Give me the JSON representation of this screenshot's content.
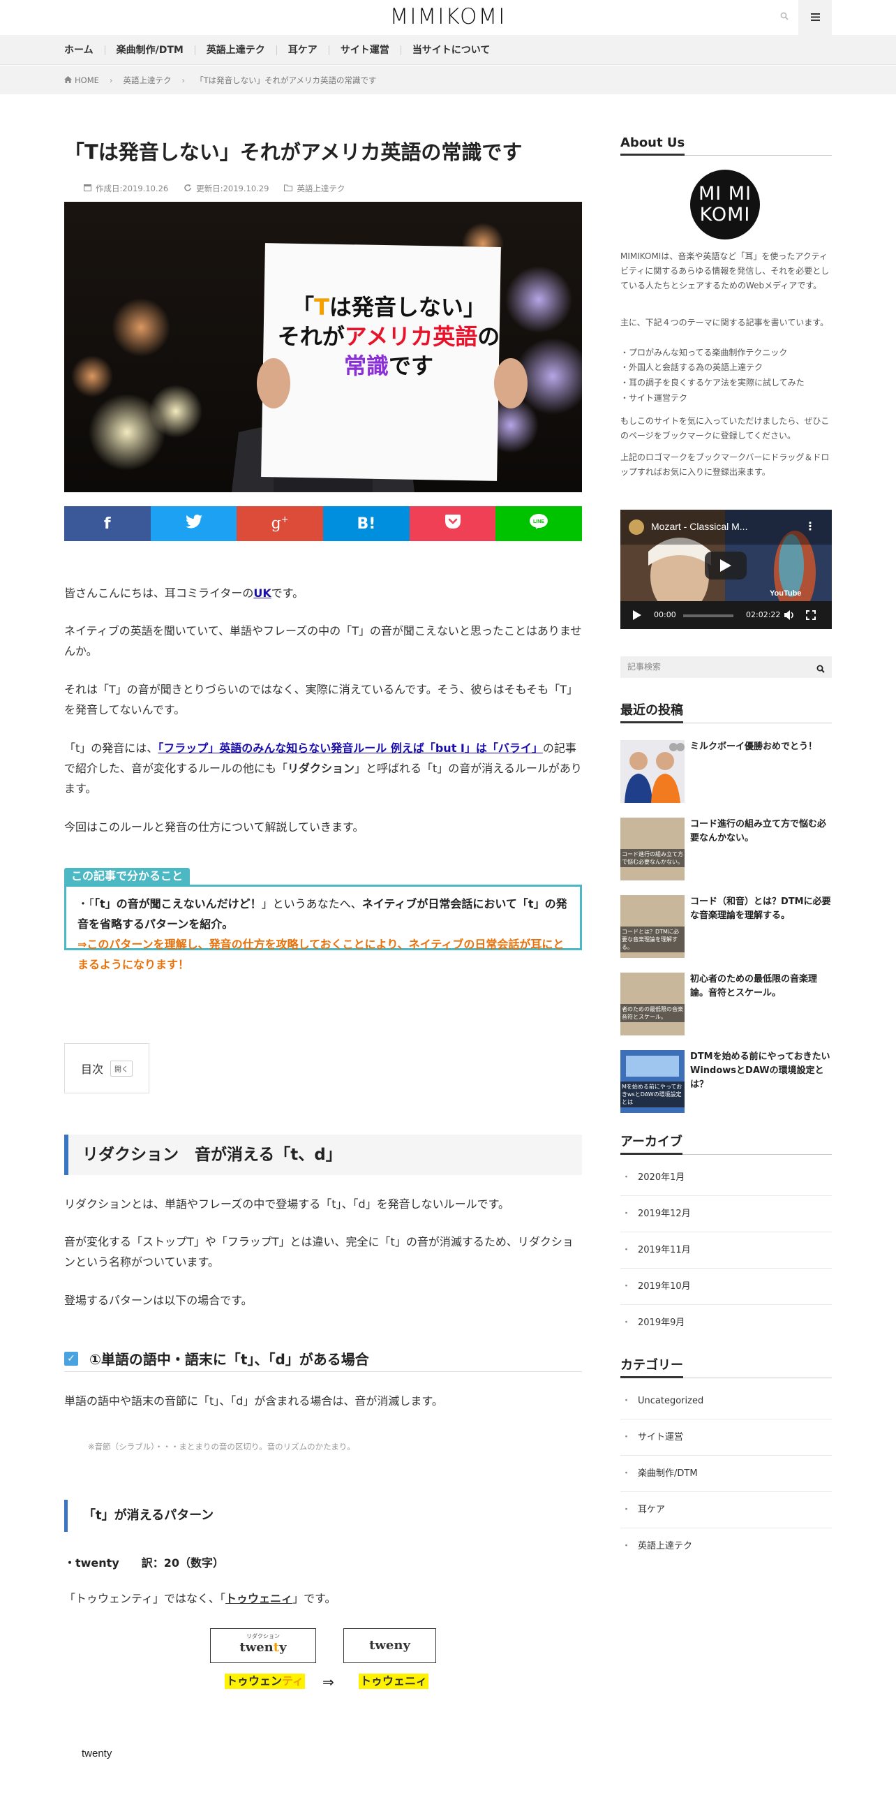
{
  "header": {
    "logo": "MIMIKOMI"
  },
  "nav": {
    "items": [
      "ホーム",
      "楽曲制作/DTM",
      "英語上達テク",
      "耳ケア",
      "サイト運営",
      "当サイトについて"
    ]
  },
  "breadcrumb": {
    "home": "HOME",
    "category": "英語上達テク",
    "current": "「Tは発音しない」それがアメリカ英語の常識です"
  },
  "article": {
    "title": "「Tは発音しない」それがアメリカ英語の常識です",
    "created": "作成日:2019.10.26",
    "updated": "更新日:2019.10.29",
    "category": "英語上達テク",
    "eyecatch": {
      "line1_a": "「",
      "line1_t": "T",
      "line1_b": "は発音しない」",
      "line2_a": "それが",
      "line2_b": "アメリカ英語",
      "line2_c": "の",
      "line3_a": "常識",
      "line3_b": "です"
    },
    "p1_a": "皆さんこんにちは、耳コミライターの",
    "p1_link": "UK",
    "p1_b": "です。",
    "p2": "ネイティブの英語を聞いていて、単語やフレーズの中の「T」の音が聞こえないと思ったことはありませんか。",
    "p3": "それは「T」の音が聞きとりづらいのではなく、実際に消えているんです。そう、彼らはそもそも「T」を発音してないんです。",
    "p4_a": "「t」の発音には、",
    "p4_link": "「フラップ」英語のみんな知らない発音ルール 例えば「but I」は「バライ」",
    "p4_b": "の記事で紹介した、音が変化するルールの他にも「",
    "p4_bold": "リダクション",
    "p4_c": "」と呼ばれる「t」の音が消えるルールがあります。",
    "p5": "今回はこのルールと発音の仕方について解説していきます。",
    "summary_tag": "この記事で分かること",
    "summary_1a": "・「",
    "summary_1b": "「t」の音が聞こえないんだけど！",
    "summary_1c": "」というあなたへ、",
    "summary_1d": "ネイティブが日常会話において「t」の発音を省略するパターンを紹介。",
    "summary_2": "⇒このパターンを理解し、発音の仕方を攻略しておくことにより、ネイティブの日常会話が耳にとまるようになります！",
    "toc_label": "目次",
    "toc_open": "開く",
    "h2": "リダクション　音が消える「t、d」",
    "p6": "リダクションとは、単語やフレーズの中で登場する「t」、「d」を発音しないルールです。",
    "p7": "音が変化する「ストップT」や「フラップT」とは違い、完全に「t」の音が消滅するため、リダクションという名称がついています。",
    "p8": "登場するパターンは以下の場合です。",
    "h3": "①単語の語中・語末に「t」、「d」がある場合",
    "p9": "単語の語中や語末の音節に「t」、「d」が含まれる場合は、音が消滅します。",
    "note": "※音節（シラブル）・・・まとまりの音の区切り。音のリズムのかたまり。",
    "h4": "「t」が消えるパターン",
    "bullet": "・twenty　　訳：20（数字）",
    "p10_a": "「トゥウェンティ」ではなく、「",
    "p10_u": "トゥウェニィ",
    "p10_b": "」です。",
    "fig_small": "リダクション",
    "fig_word_a": "twen",
    "fig_word_t": "t",
    "fig_word_b": "y",
    "fig_word2": "tweny",
    "fig_kana1_a": "トゥウェン",
    "fig_kana1_b": "ティ",
    "fig_arrow": "⇒",
    "fig_kana2": "トゥウェニィ",
    "bottom_word": "twenty"
  },
  "sidebar": {
    "about_title": "About Us",
    "about_logo_1": "MI MI",
    "about_logo_2": "KOMI",
    "about_p1": "MIMIKOMIは、音楽や英語など「耳」を使ったアクティビティに関するあらゆる情報を発信し、それを必要としている人たちとシェアするためのWebメディアです。",
    "about_p2": "主に、下記４つのテーマに関する記事を書いています。",
    "about_list": [
      "・プロがみんな知ってる楽曲制作テクニック",
      "・外国人と会話する為の英語上達テク",
      "・耳の調子を良くするケア法を実際に試してみた",
      "・サイト運営テク"
    ],
    "about_p3": "もしこのサイトを気に入っていただけましたら、ぜひこのページをブックマークに登録してください。",
    "about_p4": "上記のロゴマークをブックマークバーにドラッグ＆ドロップすればお気に入りに登録出来ます。",
    "video_title": "Mozart - Classical M...",
    "video_time": "00:00",
    "video_duration": "02:02:22",
    "video_brand": "YouTube",
    "search_placeholder": "記事検索",
    "recent_title": "最近の投稿",
    "recent": [
      {
        "title": "ミルクボーイ優勝おめでとう！"
      },
      {
        "title": "コード進行の組み立て方で悩む必要なんかない。",
        "thumb": "コード進行の組み立て方で悩む必要なんかない。"
      },
      {
        "title": "コード（和音）とは？DTMに必要な音楽理論を理解する。",
        "thumb": "コードとは？DTMに必要な音楽理論を理解する。"
      },
      {
        "title": "初心者のための最低限の音楽理論。音符とスケール。",
        "thumb": "者のための最低限の音楽音符とスケール。"
      },
      {
        "title": "DTMを始める前にやっておきたいWindowsとDAWの環境設定とは？",
        "thumb": "Mを始める前にやっておきwsとDAWの環境設定とは"
      }
    ],
    "archive_title": "アーカイブ",
    "archives": [
      "2020年1月",
      "2019年12月",
      "2019年11月",
      "2019年10月",
      "2019年9月"
    ],
    "category_title": "カテゴリー",
    "categories": [
      "Uncategorized",
      "サイト運営",
      "楽曲制作/DTM",
      "耳ケア",
      "英語上達テク"
    ],
    "bullet_mark": "・"
  },
  "colors": {
    "accent": "#3a75c4",
    "summary": "#4bb8c4",
    "orange": "#e8710a",
    "facebook": "#3b5998",
    "twitter": "#1da1f2",
    "googleplus": "#dd4b39",
    "hatena": "#008fde",
    "pocket": "#ef4056",
    "line": "#00c300"
  }
}
